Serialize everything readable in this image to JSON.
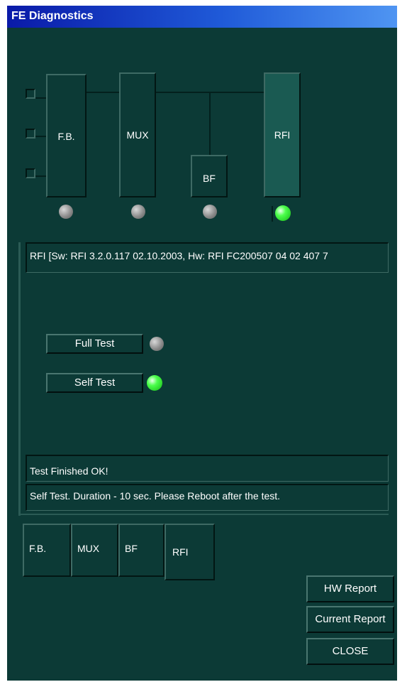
{
  "window": {
    "title": "FE Diagnostics"
  },
  "diagram": {
    "modules": [
      {
        "id": "fb",
        "label": "F.B.",
        "status": "gray"
      },
      {
        "id": "mux",
        "label": "MUX",
        "status": "gray"
      },
      {
        "id": "bf",
        "label": "BF",
        "status": "gray"
      },
      {
        "id": "rfi",
        "label": "RFI",
        "status": "green",
        "selected": true
      }
    ]
  },
  "info": {
    "version_text": "RFI [Sw: RFI 3.2.0.117 02.10.2003, Hw: RFI FC200507 04 02 407 7"
  },
  "tests": {
    "full_test_label": "Full Test",
    "full_test_status": "gray",
    "self_test_label": "Self Test",
    "self_test_status": "green"
  },
  "status": {
    "result_text": "Test Finished OK!",
    "message_text": "Self Test. Duration - 10 sec. Please Reboot after the test."
  },
  "tabs": [
    "F.B.",
    "MUX",
    "BF",
    "RFI"
  ],
  "buttons": {
    "hw_report": "HW Report",
    "current_report": "Current Report",
    "close": "CLOSE"
  },
  "colors": {
    "window_bg": "#0c3a36",
    "title_gradient_start": "#0a1aa8",
    "title_gradient_end": "#4f95f2",
    "led_green": "#4cff4c",
    "led_gray": "#8c8c8c"
  }
}
